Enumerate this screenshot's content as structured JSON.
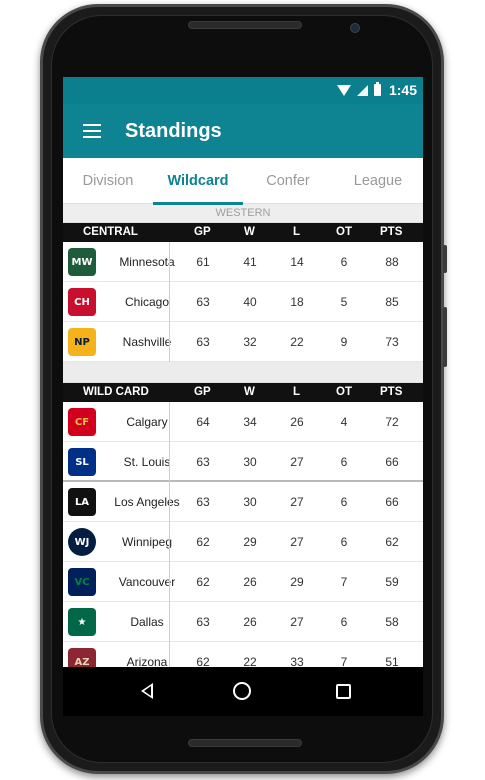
{
  "status_bar": {
    "time": "1:45"
  },
  "app_bar": {
    "title": "Standings"
  },
  "tabs": [
    {
      "label": "Division",
      "active": false
    },
    {
      "label": "Wildcard",
      "active": true
    },
    {
      "label": "Confer",
      "active": false
    },
    {
      "label": "League",
      "active": false
    }
  ],
  "conference": "WESTERN",
  "columns": {
    "gp": "GP",
    "w": "W",
    "l": "L",
    "ot": "OT",
    "pts": "PTS"
  },
  "central": {
    "label": "CENTRAL",
    "rows": [
      {
        "team": "Minnesota",
        "gp": "61",
        "w": "41",
        "l": "14",
        "ot": "6",
        "pts": "88"
      },
      {
        "team": "Chicago",
        "gp": "63",
        "w": "40",
        "l": "18",
        "ot": "5",
        "pts": "85"
      },
      {
        "team": "Nashville",
        "gp": "63",
        "w": "32",
        "l": "22",
        "ot": "9",
        "pts": "73"
      }
    ]
  },
  "wildcard": {
    "label": "WILD CARD",
    "rows": [
      {
        "team": "Calgary",
        "gp": "64",
        "w": "34",
        "l": "26",
        "ot": "4",
        "pts": "72"
      },
      {
        "team": "St. Louis",
        "gp": "63",
        "w": "30",
        "l": "27",
        "ot": "6",
        "pts": "66"
      },
      {
        "team": "Los Angeles",
        "gp": "63",
        "w": "30",
        "l": "27",
        "ot": "6",
        "pts": "66"
      },
      {
        "team": "Winnipeg",
        "gp": "62",
        "w": "29",
        "l": "27",
        "ot": "6",
        "pts": "62"
      },
      {
        "team": "Vancouver",
        "gp": "62",
        "w": "26",
        "l": "29",
        "ot": "7",
        "pts": "59"
      },
      {
        "team": "Dallas",
        "gp": "63",
        "w": "26",
        "l": "27",
        "ot": "6",
        "pts": "58"
      },
      {
        "team": "Arizona",
        "gp": "62",
        "w": "22",
        "l": "33",
        "ot": "7",
        "pts": "51"
      }
    ]
  },
  "icons": {
    "menu": "hamburger-menu-icon",
    "back": "back-triangle-icon",
    "home": "home-circle-icon",
    "recent": "recent-apps-square-icon"
  },
  "colors": {
    "accent": "#0e8391",
    "status_bar": "#0b7f8d",
    "header_black": "#111111"
  }
}
